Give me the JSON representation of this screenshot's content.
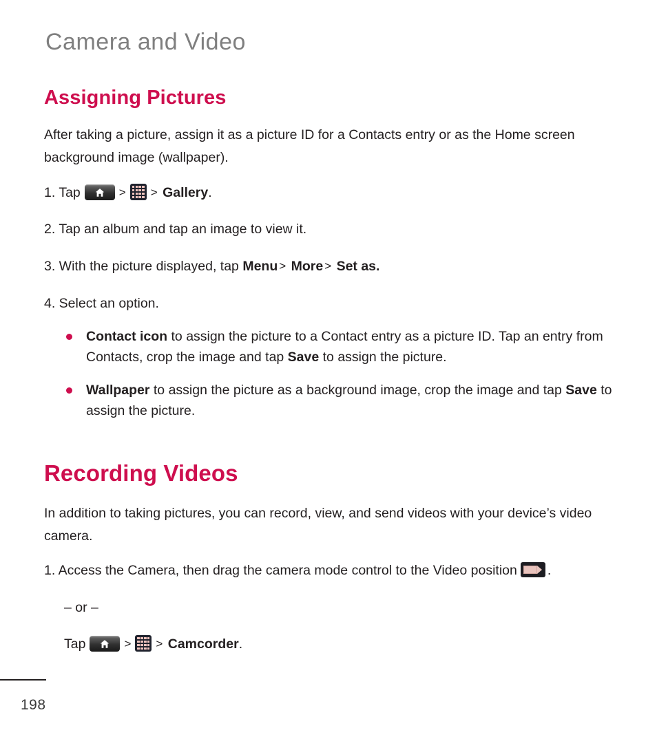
{
  "document": {
    "chapter_title": "Camera and Video",
    "page_number": "198",
    "accent_color": "#CE0E4E",
    "chapter_title_color": "#7F7F7F",
    "body_color": "#231F20"
  },
  "sections": {
    "assigning_pictures": {
      "heading": "Assigning Pictures",
      "intro": "After taking a picture, assign it as a picture ID for a Contacts entry or as the Home screen background image (wallpaper).",
      "steps": {
        "step1_prefix": "1. Tap",
        "step1_chevron_a": ">",
        "step1_chevron_b": ">",
        "step1_target": "Gallery",
        "step1_period": ".",
        "step2": "2. Tap an album and tap an image to view it.",
        "step3_prefix": "3. With the picture displayed, tap",
        "step3_menu": "Menu",
        "step3_chevron_a": ">",
        "step3_more": "More",
        "step3_chevron_b": ">",
        "step3_setas": "Set as.",
        "step4": "4. Select an option."
      },
      "options": [
        {
          "term": "Contact icon",
          "text_a": " to assign the picture to a Contact entry as a picture ID. Tap an entry from Contacts, crop the image and tap ",
          "term_b": "Save",
          "text_b": " to assign the picture."
        },
        {
          "term": "Wallpaper",
          "text_a": " to assign the picture as a background image, crop the image and tap ",
          "term_b": "Save",
          "text_b": " to assign the picture."
        }
      ]
    },
    "recording_videos": {
      "heading": "Recording Videos",
      "intro": "In addition to taking pictures, you can record, view, and send videos with your device’s video camera.",
      "step1_prefix": "1. Access the Camera, then drag the camera mode control to the Video position",
      "step1_period": ".",
      "or_divider": "– or –",
      "step1_alt_prefix": "Tap",
      "step1_alt_chevron_a": ">",
      "step1_alt_chevron_b": ">",
      "step1_alt_target": "Camcorder",
      "step1_alt_period": "."
    }
  },
  "icons": {
    "home_key": "home-key-icon",
    "apps_key": "apps-grid-icon",
    "camcorder": "camcorder-mode-icon"
  }
}
